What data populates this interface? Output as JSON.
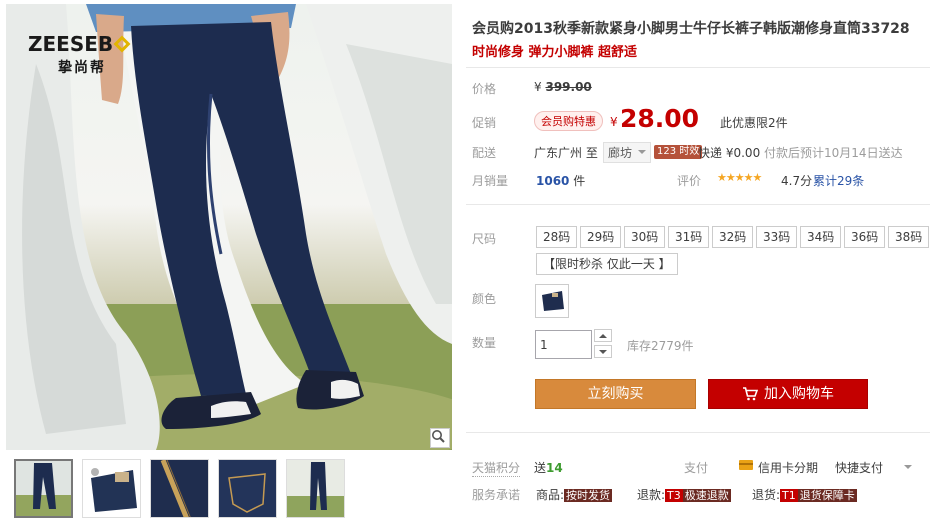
{
  "gallery": {
    "brand_name": "ZEESEB",
    "brand_sub": "挚尚帮",
    "zoom_icon": "magnifier-icon",
    "thumbnails": [
      "model-front",
      "folded-jeans",
      "zipper-closeup",
      "back-pocket",
      "model-outdoor"
    ]
  },
  "product": {
    "title": "会员购2013秋季新款紧身小脚男士牛仔长裤子韩版潮修身直筒33728",
    "subtitle": "时尚修身 弹力小脚裤 超舒适"
  },
  "price": {
    "label": "价格",
    "currency": "¥",
    "original": "399.00"
  },
  "promo": {
    "label": "促销",
    "tag": "会员购特惠",
    "currency": "¥",
    "price": "28.00",
    "limit": "此优惠限2件"
  },
  "shipping": {
    "label": "配送",
    "from": "广东广州 至",
    "to": "廊坊",
    "eta_badge": "123 时效",
    "method": "快递",
    "fee": "¥0.00",
    "note": "付款后预计10月14日送达"
  },
  "sales": {
    "label": "月销量",
    "count": "1060",
    "unit": "件",
    "rating_label": "评价",
    "stars": "★★★★★",
    "score": "4.7分",
    "reviews": "累计29条"
  },
  "size": {
    "label": "尺码",
    "options": [
      "28码",
      "29码",
      "30码",
      "31码",
      "32码",
      "33码",
      "34码",
      "36码",
      "38码"
    ],
    "flash": "【限时秒杀 仅此一天 】"
  },
  "color": {
    "label": "颜色"
  },
  "quantity": {
    "label": "数量",
    "value": "1",
    "stock": "库存2779件"
  },
  "actions": {
    "buy": "立刻购买",
    "cart": "加入购物车"
  },
  "extras": {
    "points_label": "天猫积分",
    "points_prefix": "送",
    "points_value": "14",
    "pay_label": "支付",
    "installment": "信用卡分期",
    "quickpay": "快捷支付"
  },
  "service": {
    "label": "服务承诺",
    "goods_label": "商品:",
    "goods_tag": "按时发货",
    "refund_label": "退款:",
    "refund_code": "T3",
    "refund_tag": "极速退款",
    "return_label": "退货:",
    "return_code": "T1",
    "return_tag": "退货保障卡"
  },
  "colors": {
    "accent_red": "#c40000",
    "buy_orange": "#d88a3c",
    "link_blue": "#2953a6"
  }
}
